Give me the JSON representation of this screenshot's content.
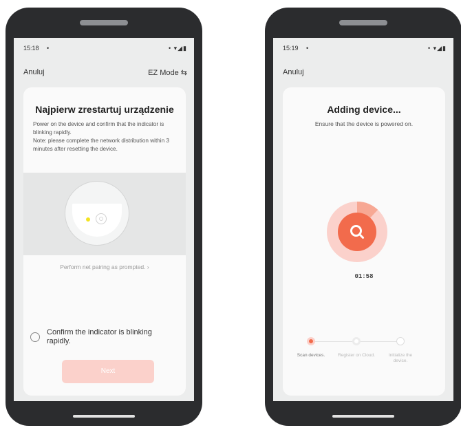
{
  "left_screen": {
    "status": {
      "time": "15:18",
      "dot": "•",
      "icons": "• ▾◢▮"
    },
    "cancel_label": "Anuluj",
    "mode_label": "EZ Mode ⇆",
    "title": "Najpierw zrestartuj urządzenie",
    "description": "Power on the device and confirm that the indicator is blinking rapidly.",
    "note": "Note: please complete the network distribution within 3 minutes after resetting the device.",
    "prompt_link": "Perform net pairing as prompted. ›",
    "confirm_label": "Confirm the indicator is blinking rapidly.",
    "next_label": "Next"
  },
  "right_screen": {
    "status": {
      "time": "15:19",
      "dot": "•",
      "icons": "• ▾◢▮"
    },
    "cancel_label": "Anuluj",
    "title": "Adding device...",
    "subtitle": "Ensure that the device is powered on.",
    "timer": "01:58",
    "progress_fraction": 0.12,
    "steps": [
      {
        "label": "Scan devices.",
        "state": "active"
      },
      {
        "label": "Register on Cloud.",
        "state": "pending"
      },
      {
        "label": "Initialize the device.",
        "state": "pending"
      }
    ]
  },
  "colors": {
    "accent": "#f26b4c",
    "accent_light": "#fbd1cb",
    "phone_frame": "#2b2c2e",
    "screen_bg": "#eceded",
    "card_bg": "#fafafa"
  },
  "icons": {
    "search": "search-icon",
    "wifi": "wifi-icon",
    "signal": "signal-icon",
    "battery": "battery-icon",
    "swap": "swap-icon"
  }
}
